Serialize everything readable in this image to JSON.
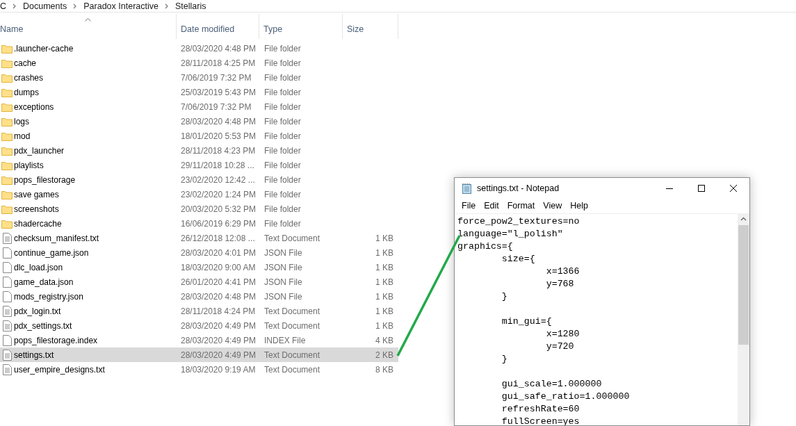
{
  "breadcrumb": [
    "C",
    "Documents",
    "Paradox Interactive",
    "Stellaris"
  ],
  "columns": [
    {
      "label": "Name",
      "sorted": true
    },
    {
      "label": "Date modified",
      "sorted": false
    },
    {
      "label": "Type",
      "sorted": false
    },
    {
      "label": "Size",
      "sorted": false
    }
  ],
  "files": [
    {
      "name": ".launcher-cache",
      "date": "28/03/2020 4:48 PM",
      "type": "File folder",
      "kind": "folder",
      "selected": false
    },
    {
      "name": "cache",
      "date": "28/11/2018 4:25 PM",
      "type": "File folder",
      "kind": "folder",
      "selected": false
    },
    {
      "name": "crashes",
      "date": "7/06/2019 7:32 PM",
      "type": "File folder",
      "kind": "folder",
      "selected": false
    },
    {
      "name": "dumps",
      "date": "25/03/2019 5:43 PM",
      "type": "File folder",
      "kind": "folder",
      "selected": false
    },
    {
      "name": "exceptions",
      "date": "7/06/2019 7:32 PM",
      "type": "File folder",
      "kind": "folder",
      "selected": false
    },
    {
      "name": "logs",
      "date": "28/03/2020 4:48 PM",
      "type": "File folder",
      "kind": "folder",
      "selected": false
    },
    {
      "name": "mod",
      "date": "18/01/2020 5:53 PM",
      "type": "File folder",
      "kind": "folder",
      "selected": false
    },
    {
      "name": "pdx_launcher",
      "date": "28/11/2018 4:23 PM",
      "type": "File folder",
      "kind": "folder",
      "selected": false
    },
    {
      "name": "playlists",
      "date": "29/11/2018 10:28 ...",
      "type": "File folder",
      "kind": "folder",
      "selected": false
    },
    {
      "name": "pops_filestorage",
      "date": "23/02/2020 12:42 ...",
      "type": "File folder",
      "kind": "folder",
      "selected": false
    },
    {
      "name": "save games",
      "date": "23/02/2020 1:24 PM",
      "type": "File folder",
      "kind": "folder",
      "selected": false
    },
    {
      "name": "screenshots",
      "date": "20/03/2020 5:32 PM",
      "type": "File folder",
      "kind": "folder",
      "selected": false
    },
    {
      "name": "shadercache",
      "date": "16/06/2019 6:29 PM",
      "type": "File folder",
      "kind": "folder",
      "selected": false
    },
    {
      "name": "checksum_manifest.txt",
      "date": "26/12/2018 12:08 ...",
      "type": "Text Document",
      "size": "1 KB",
      "kind": "text",
      "selected": false
    },
    {
      "name": "continue_game.json",
      "date": "28/03/2020 4:01 PM",
      "type": "JSON File",
      "size": "1 KB",
      "kind": "plain",
      "selected": false
    },
    {
      "name": "dlc_load.json",
      "date": "18/03/2020 9:00 AM",
      "type": "JSON File",
      "size": "1 KB",
      "kind": "plain",
      "selected": false
    },
    {
      "name": "game_data.json",
      "date": "26/01/2020 4:41 PM",
      "type": "JSON File",
      "size": "1 KB",
      "kind": "plain",
      "selected": false
    },
    {
      "name": "mods_registry.json",
      "date": "28/03/2020 4:48 PM",
      "type": "JSON File",
      "size": "1 KB",
      "kind": "plain",
      "selected": false
    },
    {
      "name": "pdx_login.txt",
      "date": "28/11/2018 4:24 PM",
      "type": "Text Document",
      "size": "1 KB",
      "kind": "text",
      "selected": false
    },
    {
      "name": "pdx_settings.txt",
      "date": "28/03/2020 4:49 PM",
      "type": "Text Document",
      "size": "1 KB",
      "kind": "text",
      "selected": false
    },
    {
      "name": "pops_filestorage.index",
      "date": "28/03/2020 4:49 PM",
      "type": "INDEX File",
      "size": "4 KB",
      "kind": "plain",
      "selected": false
    },
    {
      "name": "settings.txt",
      "date": "28/03/2020 4:49 PM",
      "type": "Text Document",
      "size": "2 KB",
      "kind": "text",
      "selected": true
    },
    {
      "name": "user_empire_designs.txt",
      "date": "18/03/2020 9:19 AM",
      "type": "Text Document",
      "size": "8 KB",
      "kind": "text",
      "selected": false
    }
  ],
  "notepad": {
    "title": "settings.txt - Notepad",
    "menu": [
      "File",
      "Edit",
      "Format",
      "View",
      "Help"
    ],
    "content": "force_pow2_textures=no\nlanguage=\"l_polish\"\ngraphics={\n\tsize={\n\t\tx=1366\n\t\ty=768\n\t}\n\n\tmin_gui={\n\t\tx=1280\n\t\ty=720\n\t}\n\n\tgui_scale=1.000000\n\tgui_safe_ratio=1.000000\n\trefreshRate=60\n\tfullScreen=yes"
  }
}
